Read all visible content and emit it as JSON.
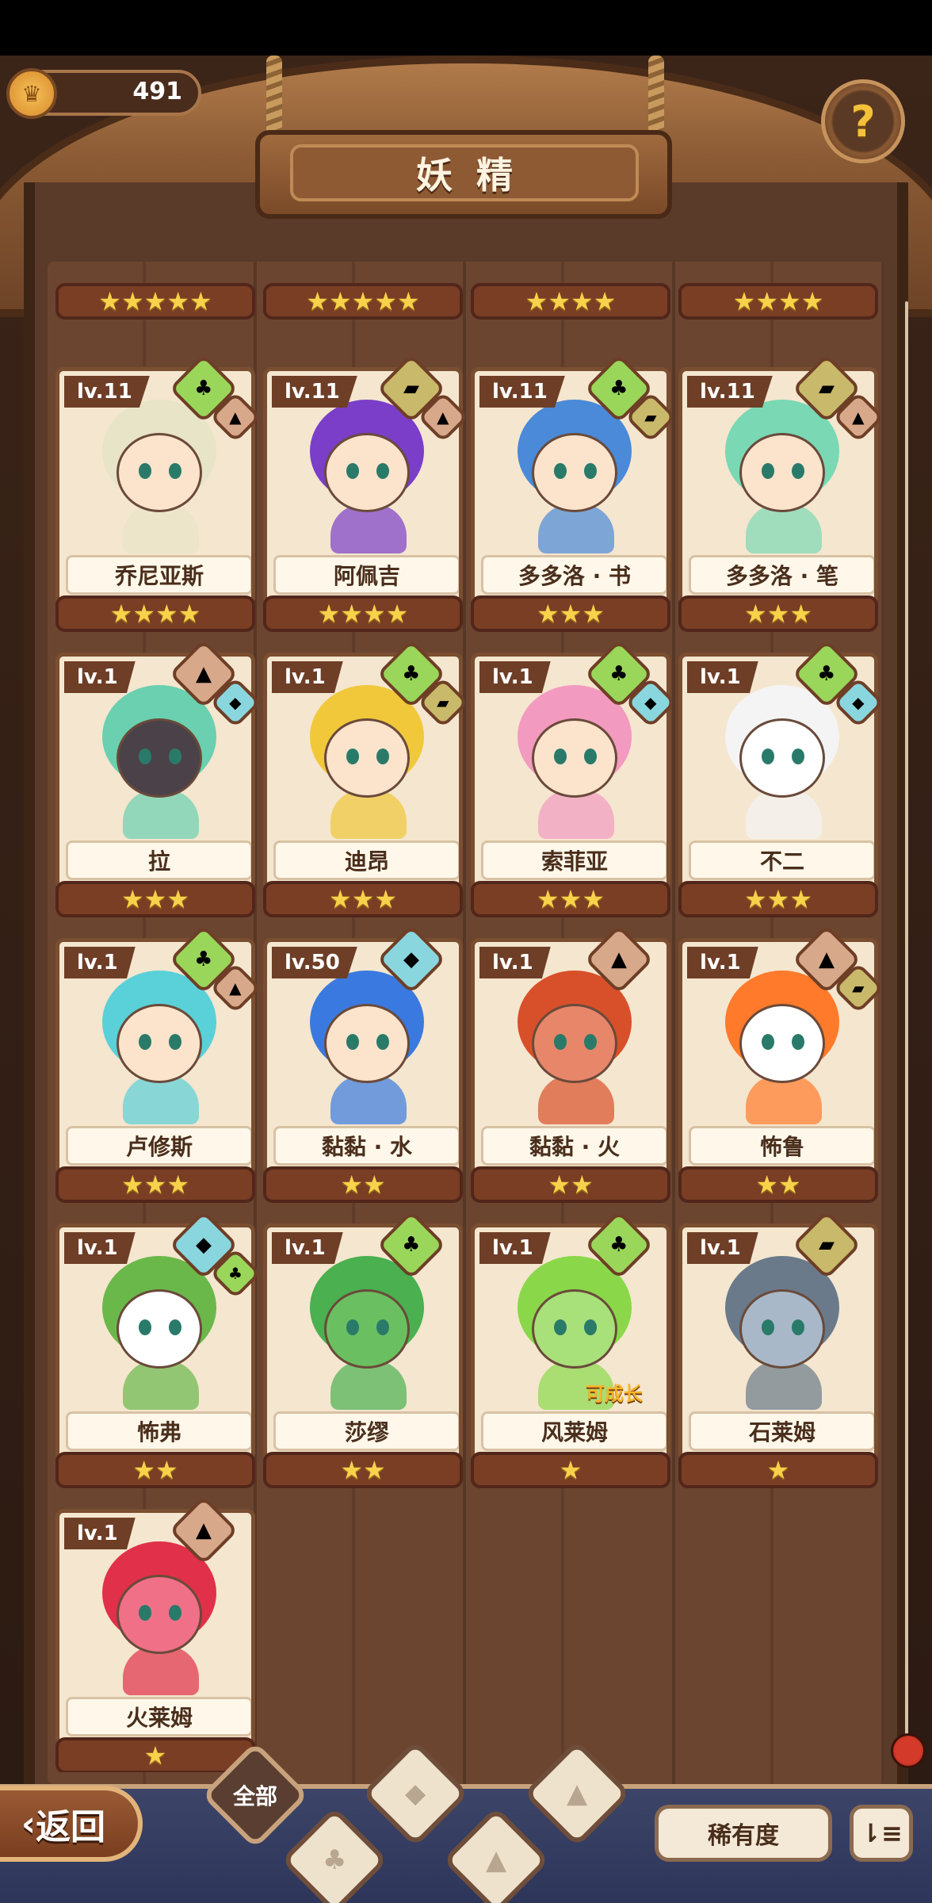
{
  "header": {
    "title": "妖精",
    "coins": "491",
    "help_symbol": "?"
  },
  "top_row_partial": [
    {
      "stars": "★★★★★"
    },
    {
      "stars": "★★★★★"
    },
    {
      "stars": "★★★★"
    },
    {
      "stars": "★★★★"
    }
  ],
  "cards": [
    {
      "level": "lv.11",
      "name": "乔尼亚斯",
      "stars": "★★★★",
      "elements": [
        "plant",
        "rock"
      ],
      "hair": "#e8e4c8",
      "skin": "#fbe3cc"
    },
    {
      "level": "lv.11",
      "name": "阿佩吉",
      "stars": "★★★★",
      "elements": [
        "earth",
        "rock"
      ],
      "hair": "#7a3ec8",
      "skin": "#fbe3cc"
    },
    {
      "level": "lv.11",
      "name": "多多洛 · 书",
      "stars": "★★★",
      "elements": [
        "plant",
        "earth"
      ],
      "hair": "#4a8ad8",
      "skin": "#fbe3cc"
    },
    {
      "level": "lv.11",
      "name": "多多洛 · 笔",
      "stars": "★★★",
      "elements": [
        "earth",
        "rock"
      ],
      "hair": "#7ad8b4",
      "skin": "#fbe3cc"
    },
    {
      "level": "lv.1",
      "name": "拉",
      "stars": "★★★",
      "elements": [
        "rock",
        "water"
      ],
      "hair": "#6ad0b0",
      "skin": "#4a4248"
    },
    {
      "level": "lv.1",
      "name": "迪昂",
      "stars": "★★★",
      "elements": [
        "plant",
        "earth"
      ],
      "hair": "#f0c83a",
      "skin": "#fbe3cc"
    },
    {
      "level": "lv.1",
      "name": "索菲亚",
      "stars": "★★★",
      "elements": [
        "plant",
        "water"
      ],
      "hair": "#f29ac0",
      "skin": "#fbe3cc"
    },
    {
      "level": "lv.1",
      "name": "不二",
      "stars": "★★★",
      "elements": [
        "plant",
        "water"
      ],
      "hair": "#f4f4f4",
      "skin": "#ffffff"
    },
    {
      "level": "lv.1",
      "name": "卢修斯",
      "stars": "★★★",
      "elements": [
        "plant",
        "rock"
      ],
      "hair": "#5ad0d8",
      "skin": "#fbe3cc"
    },
    {
      "level": "lv.50",
      "name": "黏黏 · 水",
      "stars": "★★",
      "elements": [
        "water"
      ],
      "hair": "#3a7ae0",
      "skin": "#fbe3cc"
    },
    {
      "level": "lv.1",
      "name": "黏黏 · 火",
      "stars": "★★",
      "elements": [
        "rock"
      ],
      "hair": "#d8502a",
      "skin": "#e8866a"
    },
    {
      "level": "lv.1",
      "name": "怖鲁",
      "stars": "★★",
      "elements": [
        "rock",
        "earth"
      ],
      "hair": "#ff7a2a",
      "skin": "#ffffff"
    },
    {
      "level": "lv.1",
      "name": "怖弗",
      "stars": "★★",
      "elements": [
        "water",
        "plant"
      ],
      "hair": "#6ab84a",
      "skin": "#ffffff"
    },
    {
      "level": "lv.1",
      "name": "莎缪",
      "stars": "★★",
      "elements": [
        "plant"
      ],
      "hair": "#4ab050",
      "skin": "#6ac060"
    },
    {
      "level": "lv.1",
      "name": "风莱姆",
      "stars": "★",
      "elements": [
        "plant"
      ],
      "hair": "#8ad84a",
      "skin": "#a8e07a",
      "tag": "可成长"
    },
    {
      "level": "lv.1",
      "name": "石莱姆",
      "stars": "★",
      "elements": [
        "earth"
      ],
      "hair": "#6a7a8a",
      "skin": "#a8b8c8"
    },
    {
      "level": "lv.1",
      "name": "火莱姆",
      "stars": "★",
      "elements": [
        "rock"
      ],
      "hair": "#e0304a",
      "skin": "#f07088"
    }
  ],
  "bottom": {
    "back_label": "返回",
    "filter_all": "全部",
    "rarity_label": "稀有度",
    "sort_symbol": "⇂≡"
  },
  "colors": {
    "plant": "#9ad65a",
    "earth": "#c9b96a",
    "rock": "#d8a88a",
    "water": "#8ad6de",
    "star": "#f7d24a"
  },
  "icons": {
    "plant": "🌱",
    "earth": "▱",
    "rock": "⛰",
    "water": "💧"
  }
}
